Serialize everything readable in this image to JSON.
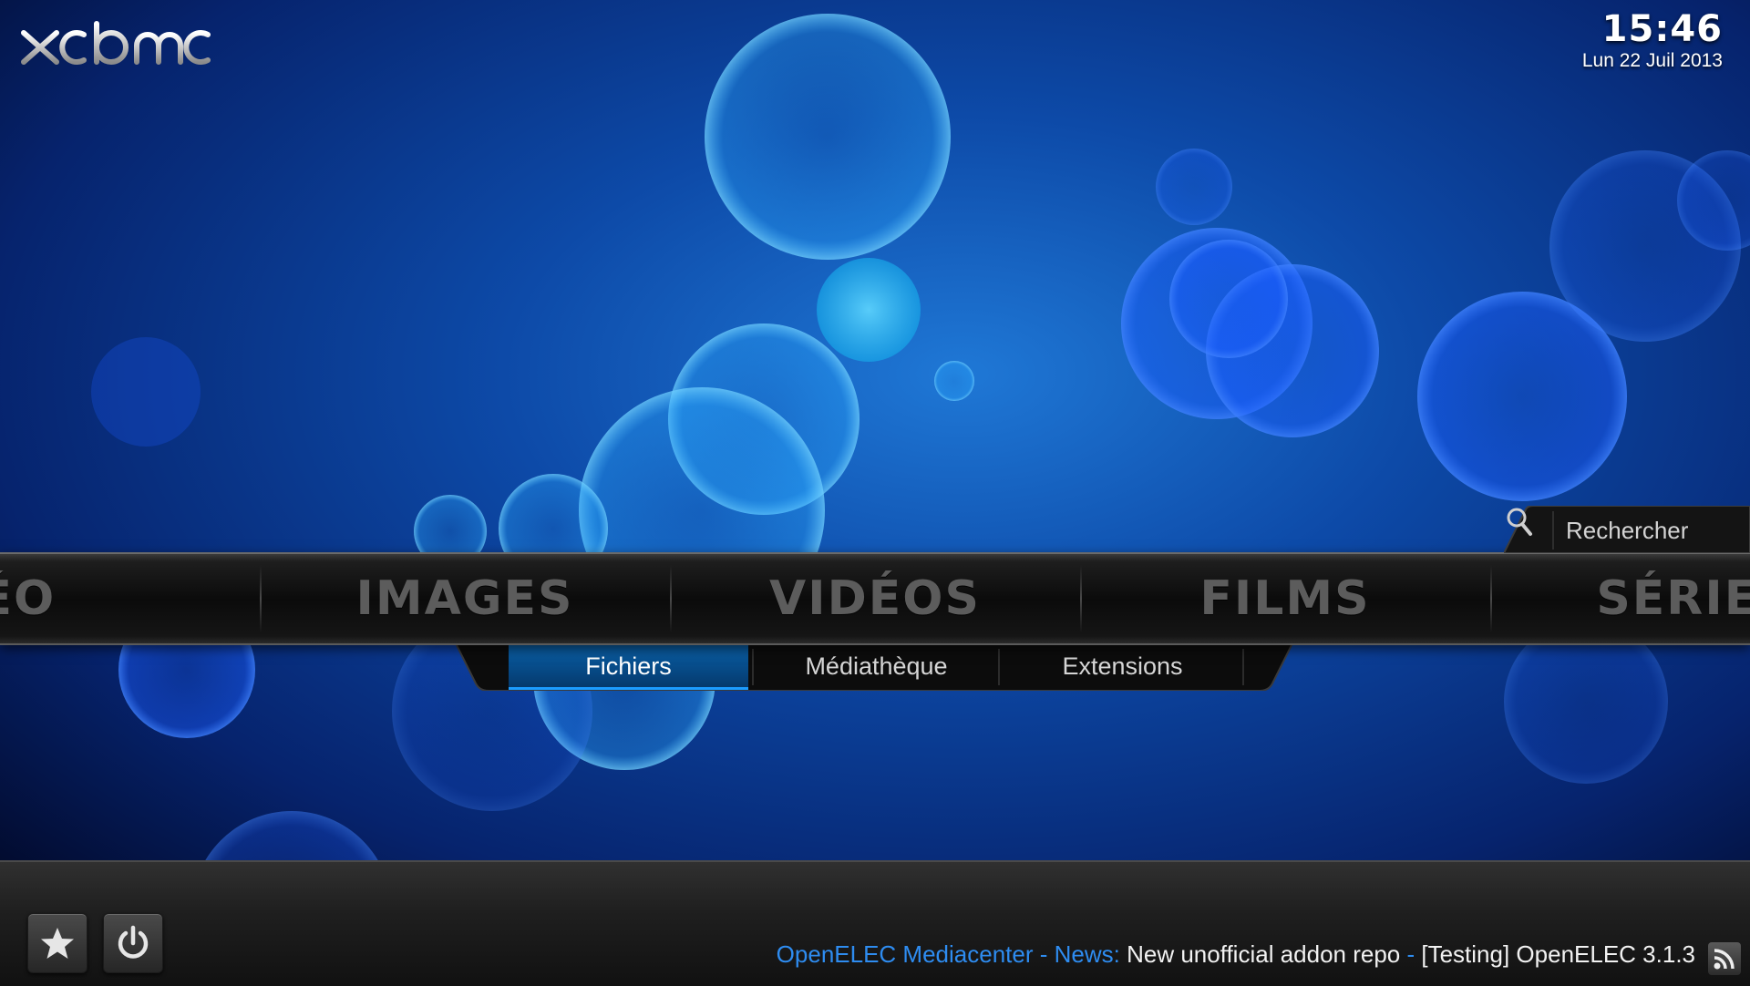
{
  "app": {
    "logo_text": "XBMC"
  },
  "clock": {
    "time": "15:46",
    "date": "Lun 22 Juil 2013"
  },
  "search": {
    "label": "Rechercher",
    "icon": "search-icon"
  },
  "main_menu": {
    "items": [
      {
        "label": "MÉTÉO",
        "id": "weather"
      },
      {
        "label": "IMAGES",
        "id": "images"
      },
      {
        "label": "VIDÉOS",
        "id": "videos"
      },
      {
        "label": "FILMS",
        "id": "films"
      },
      {
        "label": "SÉRIES",
        "id": "series"
      }
    ]
  },
  "sub_menu": {
    "items": [
      {
        "label": "Fichiers",
        "active": true
      },
      {
        "label": "Médiathèque",
        "active": false
      },
      {
        "label": "Extensions",
        "active": false
      }
    ]
  },
  "bottom": {
    "favourites_icon": "star-icon",
    "power_icon": "power-icon",
    "ticker": {
      "source": "OpenELEC Mediacenter",
      "sep1": " - ",
      "category": "News:",
      "headline1": " New unofficial addon repo ",
      "sep2": "- ",
      "headline2": "[Testing] OpenELEC 3.1.3"
    },
    "rss_icon": "rss-icon"
  },
  "colors": {
    "accent": "#1b9cff",
    "ticker_blue": "#2e8cf0",
    "menu_text": "#5c5c5c",
    "background": "#04124a"
  }
}
